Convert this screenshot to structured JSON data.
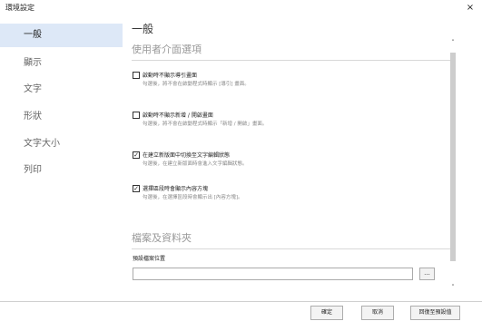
{
  "window": {
    "title": "環境設定",
    "close_glyph": "×"
  },
  "sidebar": {
    "items": [
      {
        "label": "一般",
        "active": true
      },
      {
        "label": "顯示"
      },
      {
        "label": "文字"
      },
      {
        "label": "形狀"
      },
      {
        "label": "文字大小"
      },
      {
        "label": "列印"
      }
    ]
  },
  "main": {
    "page_title": "一般",
    "sections": {
      "ui_options": {
        "title": "使用者介面選項",
        "options": [
          {
            "label": "啟動時不顯示導引畫面",
            "description": "勾選後，將不會在啟動程式時顯示 [導引] 畫面。",
            "checked": false
          },
          {
            "label": "啟動時不顯示新增 / 開啟畫面",
            "description": "勾選後，將不會在啟動程式時顯示「新增 / 開啟」畫面。",
            "checked": false
          },
          {
            "label": "在建立新版面中切換至文字編輯狀態",
            "description": "勾選後，在建立新版面時會進入文字編輯狀態。",
            "checked": true
          },
          {
            "label": "選擇區段時會顯示內容方塊",
            "description": "勾選後，在選擇區段時會顯示出 [內容方塊]。",
            "checked": true
          }
        ]
      },
      "files": {
        "title": "檔案及資料夾",
        "default_location_label": "預設檔案位置",
        "default_location_value": "",
        "browse_label": "..."
      }
    }
  },
  "scroll": {
    "up_glyph": "˄",
    "down_glyph": "˅"
  },
  "footer": {
    "ok_label": "確定",
    "cancel_label": "取消",
    "reset_label": "回復至預設值"
  },
  "colors": {
    "active_bg": "#dde8f7",
    "scroll_thumb": "#cdcdcd"
  }
}
